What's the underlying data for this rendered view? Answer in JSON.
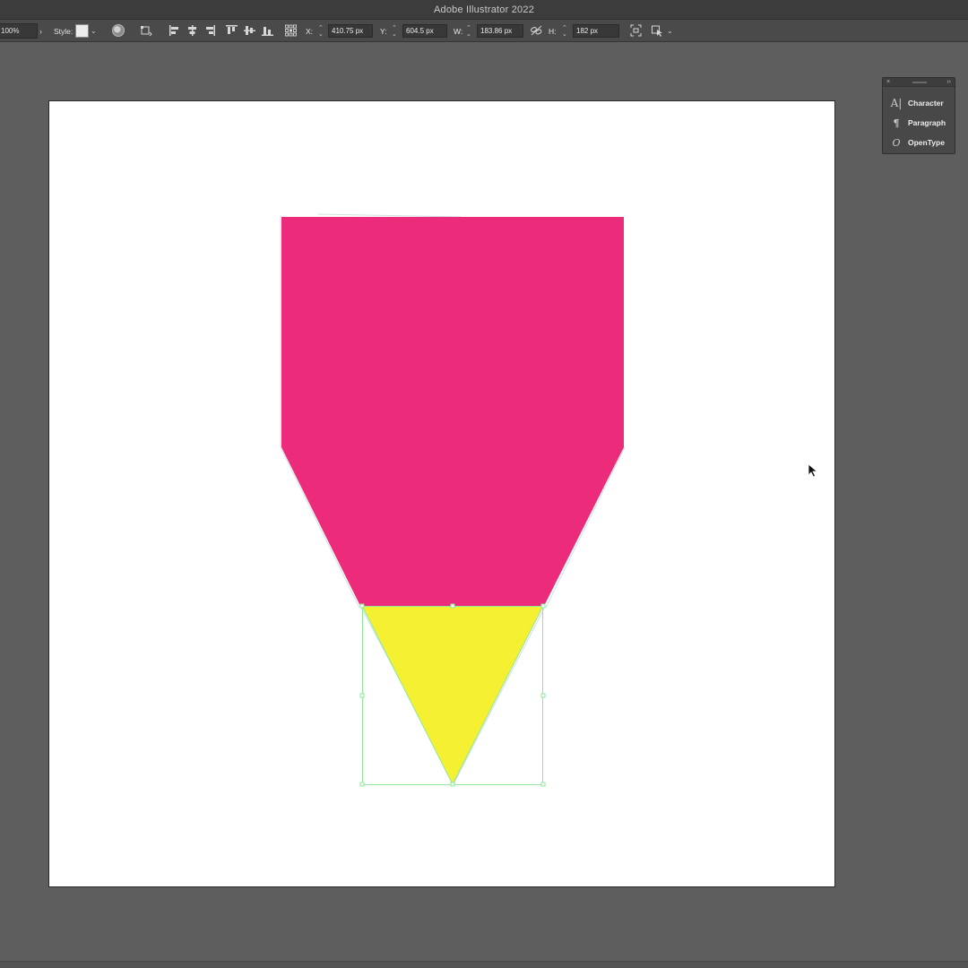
{
  "app": {
    "title": "Adobe Illustrator 2022"
  },
  "control_bar": {
    "zoom": "100%",
    "style_label": "Style:",
    "x_label": "X:",
    "x_value": "410.75 px",
    "y_label": "Y:",
    "y_value": "604.5 px",
    "w_label": "W:",
    "w_value": "183.86 px",
    "h_label": "H:",
    "h_value": "182 px"
  },
  "panel": {
    "items": [
      {
        "label": "Character",
        "icon": "character-icon",
        "glyph": "A|"
      },
      {
        "label": "Paragraph",
        "icon": "paragraph-icon",
        "glyph": "¶"
      },
      {
        "label": "OpenType",
        "icon": "opentype-icon",
        "glyph": "O"
      }
    ]
  },
  "artwork": {
    "upper_shape_color": "#ec2b7a",
    "triangle_color": "#f5f032",
    "selection_color": "#8fe89a"
  }
}
